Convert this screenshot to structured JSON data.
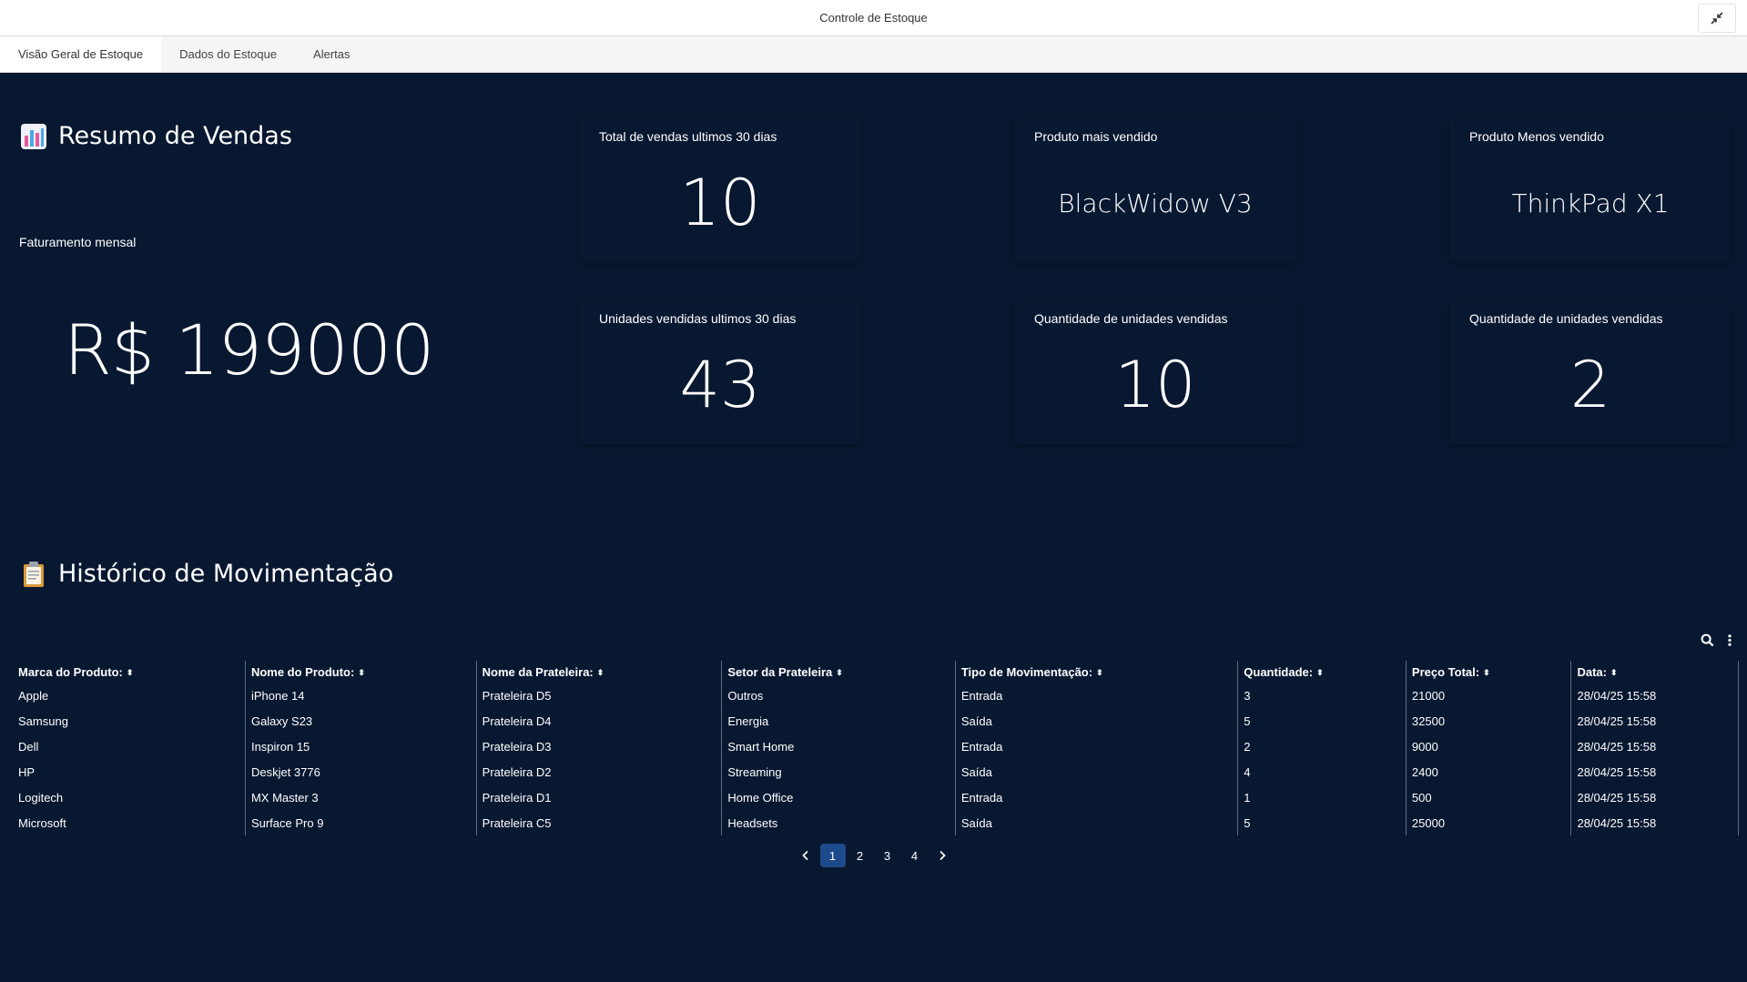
{
  "window": {
    "title": "Controle de Estoque"
  },
  "tabs": [
    {
      "label": "Visão Geral de Estoque",
      "active": true
    },
    {
      "label": "Dados do Estoque",
      "active": false
    },
    {
      "label": "Alertas",
      "active": false
    }
  ],
  "sales": {
    "title": "Resumo de Vendas",
    "icon": "bar-chart-icon",
    "revenue_label": "Faturamento mensal",
    "revenue_value": "R$ 199000"
  },
  "cards": [
    {
      "title": "Total de vendas ultimos 30 dias",
      "value": "10"
    },
    {
      "title": "Produto mais vendido",
      "value": "BlackWidow V3"
    },
    {
      "title": "Produto Menos vendido",
      "value": "ThinkPad X1"
    },
    {
      "title": "Unidades vendidas ultimos 30 dias",
      "value": "43"
    },
    {
      "title": "Quantidade de unidades vendidas",
      "value": "10"
    },
    {
      "title": "Quantidade de unidades vendidas",
      "value": "2"
    }
  ],
  "history": {
    "title": "Histórico de Movimentação",
    "icon": "clipboard-icon",
    "columns": [
      "Marca do Produto:",
      "Nome do Produto:",
      "Nome da Prateleira:",
      "Setor da Prateleira",
      "Tipo de Movimentação:",
      "Quantidade:",
      "Preço Total:",
      "Data:"
    ],
    "rows": [
      [
        "Apple",
        "iPhone 14",
        "Prateleira D5",
        "Outros",
        "Entrada",
        "3",
        "21000",
        "28/04/25 15:58"
      ],
      [
        "Samsung",
        "Galaxy S23",
        "Prateleira D4",
        "Energia",
        "Saída",
        "5",
        "32500",
        "28/04/25 15:58"
      ],
      [
        "Dell",
        "Inspiron 15",
        "Prateleira D3",
        "Smart Home",
        "Entrada",
        "2",
        "9000",
        "28/04/25 15:58"
      ],
      [
        "HP",
        "Deskjet 3776",
        "Prateleira D2",
        "Streaming",
        "Saída",
        "4",
        "2400",
        "28/04/25 15:58"
      ],
      [
        "Logitech",
        "MX Master 3",
        "Prateleira D1",
        "Home Office",
        "Entrada",
        "1",
        "500",
        "28/04/25 15:58"
      ],
      [
        "Microsoft",
        "Surface Pro 9",
        "Prateleira C5",
        "Headsets",
        "Saída",
        "5",
        "25000",
        "28/04/25 15:58"
      ]
    ],
    "pagination": {
      "pages": [
        "1",
        "2",
        "3",
        "4"
      ],
      "current": "1"
    }
  },
  "colors": {
    "background": "#091831",
    "accent": "#1d4a8a"
  }
}
